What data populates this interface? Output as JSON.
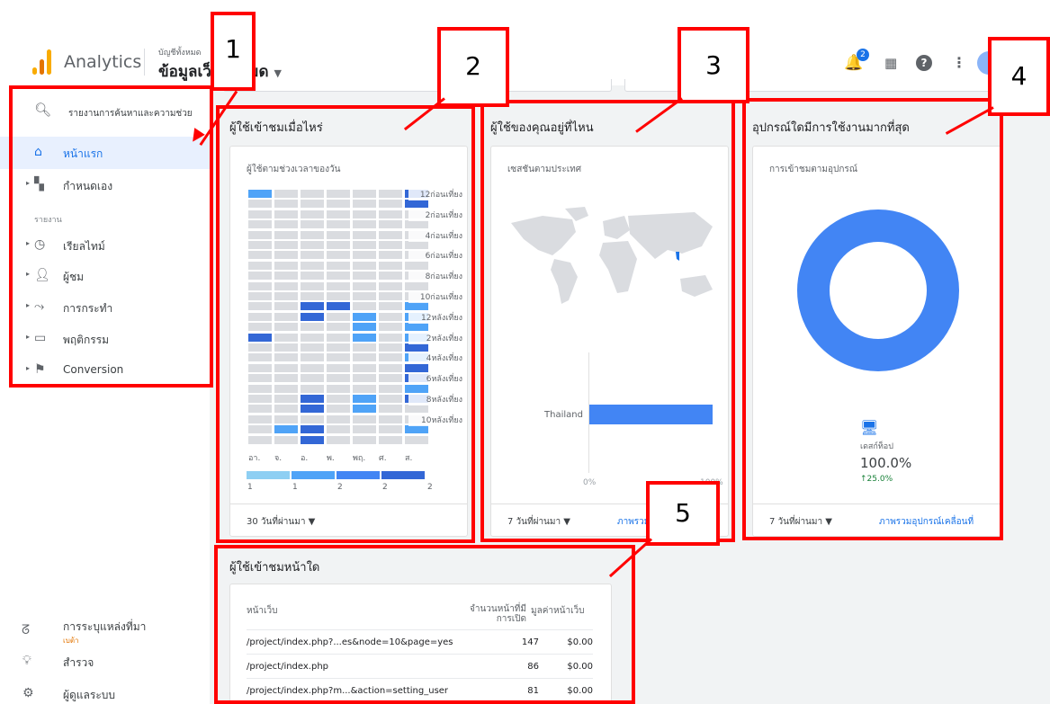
{
  "header": {
    "app_title": "Analytics",
    "account_small": "บัญชีทั้งหมด",
    "account_big": "ข้อมูลเว็บทั้งหมด",
    "notification_count": "2"
  },
  "sidebar": {
    "search_placeholder": "รายงานการค้นหาและความช่วย",
    "home": "หน้าแรก",
    "customize": "กำหนดเอง",
    "reports_section": "รายงาน",
    "items": [
      "เรียลไทม์",
      "ผู้ชม",
      "การกระทำ",
      "พฤติกรรม",
      "Conversion"
    ],
    "attribution": "การระบุแหล่งที่มา",
    "attribution_badge": "เบต้า",
    "discover": "สำรวจ",
    "admin": "ผู้ดูแลระบบ"
  },
  "cards": {
    "users_when": {
      "title": "ผู้ใช้เข้าชมเมื่อไหร่",
      "subtitle": "ผู้ใช้ตามช่วงเวลาของวัน",
      "hour_labels": [
        "12ก่อนเที่ยง",
        "2ก่อนเที่ยง",
        "4ก่อนเที่ยง",
        "6ก่อนเที่ยง",
        "8ก่อนเที่ยง",
        "10ก่อนเที่ยง",
        "12หลังเที่ยง",
        "2หลังเที่ยง",
        "4หลังเที่ยง",
        "6หลังเที่ยง",
        "8หลังเที่ยง",
        "10หลังเที่ยง"
      ],
      "day_labels": [
        "อา.",
        "จ.",
        "อ.",
        "พ.",
        "พฤ.",
        "ศ.",
        "ส."
      ],
      "legend_values": [
        "1",
        "1",
        "2",
        "2",
        "2"
      ],
      "footer": "30 วันที่ผ่านมา ▼"
    },
    "where": {
      "title": "ผู้ใช้ของคุณอยู่ที่ไหน",
      "subtitle": "เซสชันตามประเทศ",
      "country": "Thailand",
      "axis_min": "0%",
      "axis_max": "100%",
      "footer": "7 วันที่ผ่านมา ▼",
      "link": "ภาพรวมตำแหน่ง >"
    },
    "devices": {
      "title": "อุปกรณ์ใดมีการใช้งานมากที่สุด",
      "subtitle": "การเข้าชมตามอุปกรณ์",
      "device_label": "เดสก์ท็อป",
      "device_percent": "100.0%",
      "device_change": "↑25.0%",
      "footer": "7 วันที่ผ่านมา ▼",
      "link": "ภาพรวมอุปกรณ์เคลื่อนที่"
    },
    "pages": {
      "title": "ผู้ใช้เข้าชมหน้าใด",
      "col_page": "หน้าเว็บ",
      "col_views_1": "จำนวนหน้าที่มี",
      "col_views_2": "การเปิด",
      "col_value": "มูลค่าหน้าเว็บ",
      "rows": [
        {
          "page": "/project/index.php?...es&node=10&page=yes",
          "views": "147",
          "value": "$0.00"
        },
        {
          "page": "/project/index.php",
          "views": "86",
          "value": "$0.00"
        },
        {
          "page": "/project/index.php?m...&action=setting_user",
          "views": "81",
          "value": "$0.00"
        }
      ]
    }
  },
  "annotations": [
    "1",
    "2",
    "3",
    "4",
    "5"
  ],
  "colors": {
    "accent": "#1a73e8",
    "annotation": "#ff0000",
    "donut": "#4285f4",
    "bar": "#4285f4"
  }
}
